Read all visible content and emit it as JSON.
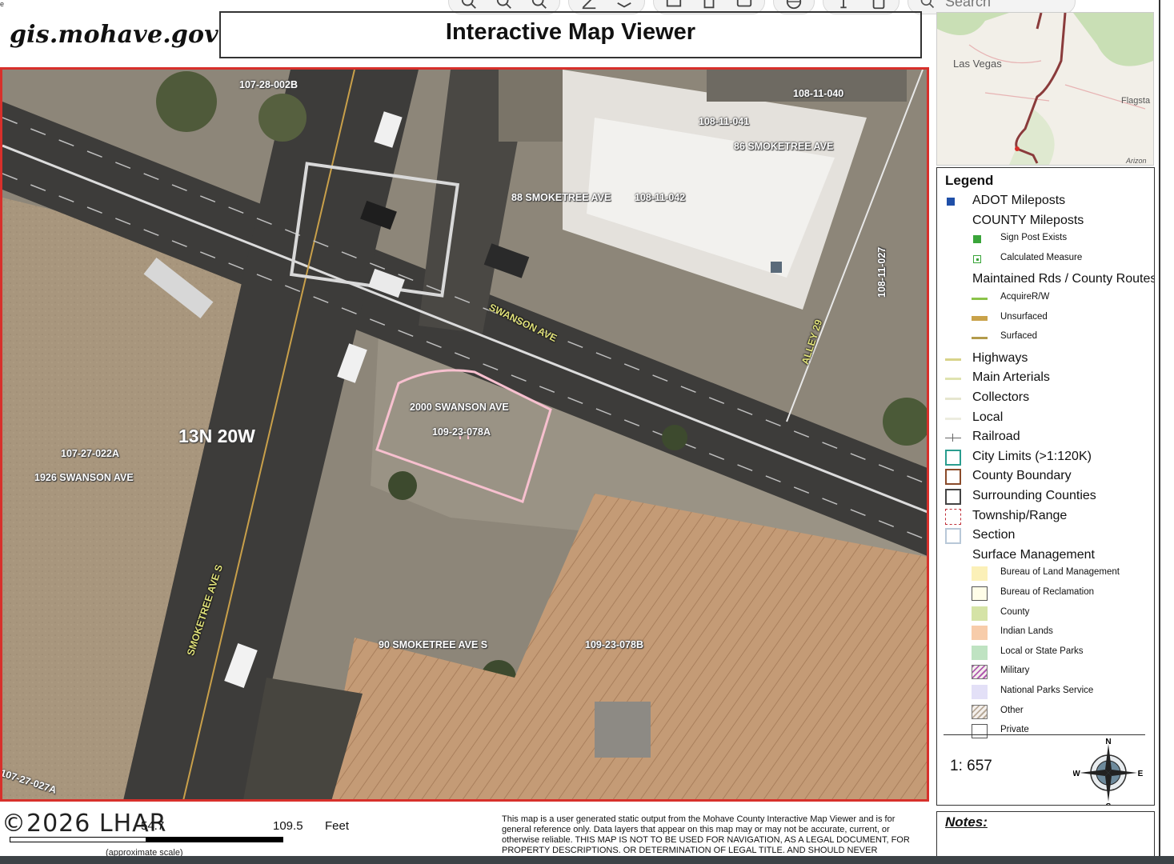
{
  "header": {
    "site_name": "gis.mohave.gov",
    "title": "Interactive Map Viewer",
    "tiny_mark": "e"
  },
  "toolbar": {
    "icons": [
      "zoom-in-icon",
      "zoom-out-icon",
      "zoom-extent-icon",
      "draw-icon",
      "layers-icon",
      "print-icon",
      "measure-icon",
      "globe-icon",
      "info-icon",
      "bookmark-icon",
      "search-icon"
    ],
    "search_placeholder": "Search"
  },
  "overview_map": {
    "labels": [
      "Las Vegas",
      "Flagsta",
      "Arizon"
    ]
  },
  "map": {
    "labels": {
      "parcel_107_28_002b": "107-28-002B",
      "parcel_108_11_040": "108-11-040",
      "parcel_108_11_041": "108-11-041",
      "addr_86_smoketree": "86 SMOKETREE AVE",
      "addr_88_smoketree": "88 SMOKETREE AVE",
      "parcel_108_11_042": "108-11-042",
      "parcel_108_11_027": "108-11-027",
      "road_swanson": "SWANSON AVE",
      "road_alley": "ALLEY 29",
      "addr_2000_swanson": "2000 SWANSON AVE",
      "parcel_109_23_078a": "109-23-078A",
      "township": "13N 20W",
      "parcel_107_27_022a": "107-27-022A",
      "addr_1926_swanson": "1926 SWANSON AVE",
      "road_smoketree": "SMOKETREE AVE S",
      "addr_90_smoketree": "90 SMOKETREE AVE S",
      "parcel_109_23_078b": "109-23-078B",
      "parcel_107_27_027a": "107-27-027A"
    }
  },
  "legend": {
    "title": "Legend",
    "items": [
      {
        "label": "ADOT Mileposts",
        "level": 1,
        "symbol": "square",
        "color": "#1f4fa8"
      },
      {
        "label": "COUNTY Mileposts",
        "level": 1,
        "symbol": "none"
      },
      {
        "label": "Sign Post Exists",
        "level": 2,
        "symbol": "square",
        "color": "#3aa53a"
      },
      {
        "label": "Calculated Measure",
        "level": 2,
        "symbol": "dot-square",
        "color": "#3aa53a"
      },
      {
        "label": "Maintained Rds / County Routes",
        "level": 1,
        "symbol": "none"
      },
      {
        "label": "AcquireR/W",
        "level": 2,
        "symbol": "line",
        "color": "#8bc34a"
      },
      {
        "label": "Unsurfaced",
        "level": 2,
        "symbol": "thick-line",
        "color": "#c9a24a"
      },
      {
        "label": "Surfaced",
        "level": 2,
        "symbol": "line",
        "color": "#b39b4b"
      },
      {
        "label": "Highways",
        "level": 1,
        "symbol": "line",
        "color": "#d8d38a"
      },
      {
        "label": "Main Arterials",
        "level": 1,
        "symbol": "line",
        "color": "#dfe3b0"
      },
      {
        "label": "Collectors",
        "level": 1,
        "symbol": "line",
        "color": "#e6e6cf"
      },
      {
        "label": "Local",
        "level": 1,
        "symbol": "line",
        "color": "#ececdf"
      },
      {
        "label": "Railroad",
        "level": 1,
        "symbol": "rail",
        "color": "#666666"
      },
      {
        "label": "City Limits (>1:120K)",
        "level": 1,
        "symbol": "box",
        "color": "#2a9d8f"
      },
      {
        "label": "County Boundary",
        "level": 1,
        "symbol": "box",
        "color": "#8a4b2a"
      },
      {
        "label": "Surrounding Counties",
        "level": 1,
        "symbol": "box",
        "color": "#444444"
      },
      {
        "label": "Township/Range",
        "level": 1,
        "symbol": "dashed-box",
        "color": "#c0303a"
      },
      {
        "label": "Section",
        "level": 1,
        "symbol": "box",
        "color": "#b8c8d8"
      },
      {
        "label": "Surface Management",
        "level": 1,
        "symbol": "none"
      },
      {
        "label": "Bureau of Land Management",
        "level": 2,
        "symbol": "fill",
        "color": "#fbf0b8"
      },
      {
        "label": "Bureau of Reclamation",
        "level": 2,
        "symbol": "outline-fill",
        "color": "#fffde8"
      },
      {
        "label": "County",
        "level": 2,
        "symbol": "fill",
        "color": "#d5e3a6"
      },
      {
        "label": "Indian Lands",
        "level": 2,
        "symbol": "fill",
        "color": "#f7ccaa"
      },
      {
        "label": "Local or State Parks",
        "level": 2,
        "symbol": "fill",
        "color": "#bfe3c2"
      },
      {
        "label": "Military",
        "level": 2,
        "symbol": "hatch",
        "color": "#b05ab0"
      },
      {
        "label": "National Parks Service",
        "level": 2,
        "symbol": "fill",
        "color": "#e3e0f7"
      },
      {
        "label": "Other",
        "level": 2,
        "symbol": "hatch",
        "color": "#b8aa99"
      },
      {
        "label": "Private",
        "level": 2,
        "symbol": "outline-fill",
        "color": "#ffffff"
      }
    ],
    "scale_ratio": "1: 657",
    "compass": {
      "n": "N",
      "s": "S",
      "e": "E",
      "w": "W"
    }
  },
  "scalebar": {
    "watermark": "©2026 LHAR",
    "v0": "54.7",
    "v1": "109.5",
    "unit": "Feet",
    "approx": "(approximate scale)"
  },
  "disclaimer": "This map is a user generated static output from the Mohave County Interactive Map Viewer and is for general reference only. Data layers that appear on this map may or may not be accurate, current, or otherwise reliable. THIS MAP IS NOT TO BE USED FOR NAVIGATION, AS A LEGAL DOCUMENT, FOR PROPERTY DESCRIPTIONS, OR DETERMINATION OF LEGAL TITLE, AND SHOULD NEVER",
  "notes": {
    "label": "Notes:"
  }
}
